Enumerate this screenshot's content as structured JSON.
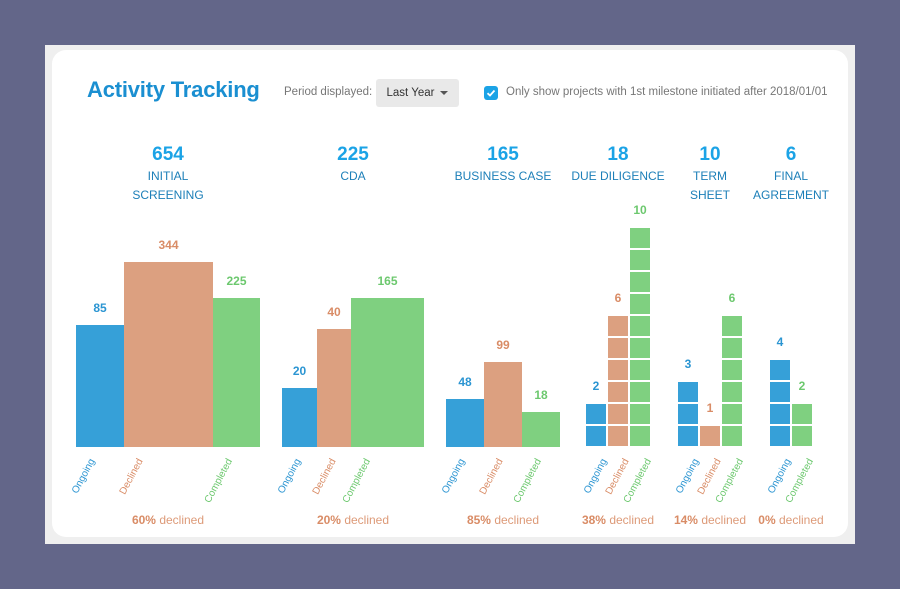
{
  "header": {
    "title": "Activity Tracking",
    "period_label": "Period displayed:",
    "period_value": "Last Year",
    "filter_checked": true,
    "filter_label": "Only show projects with 1st milestone initiated after 2018/01/01"
  },
  "colors": {
    "title": "#1a8fd1",
    "ongoing": "#36a0d8",
    "declined": "#dca080",
    "completed": "#7fd080",
    "background": "#636689"
  },
  "chart_data": {
    "type": "bar",
    "title": "Activity Tracking",
    "series_names": [
      "Ongoing",
      "Declined",
      "Completed"
    ],
    "stages": [
      {
        "name": "INITIAL SCREENING",
        "total": 654,
        "ongoing": 85,
        "declined": 344,
        "completed": 225,
        "declined_pct": "60%",
        "style": "proportional"
      },
      {
        "name": "CDA",
        "total": 225,
        "ongoing": 20,
        "declined": 40,
        "completed": 165,
        "declined_pct": "20%",
        "style": "proportional"
      },
      {
        "name": "BUSINESS CASE",
        "total": 165,
        "ongoing": 48,
        "declined": 99,
        "completed": 18,
        "declined_pct": "85%",
        "style": "proportional"
      },
      {
        "name": "DUE DILIGENCE",
        "total": 18,
        "ongoing": 2,
        "declined": 6,
        "completed": 10,
        "declined_pct": "38%",
        "style": "units"
      },
      {
        "name": "TERM SHEET",
        "total": 10,
        "ongoing": 3,
        "declined": 1,
        "completed": 6,
        "declined_pct": "14%",
        "style": "units"
      },
      {
        "name": "FINAL AGREEMENT",
        "total": 6,
        "ongoing": 4,
        "declined": null,
        "completed": 2,
        "declined_pct": "0%",
        "style": "units"
      }
    ],
    "declined_suffix": "declined"
  }
}
